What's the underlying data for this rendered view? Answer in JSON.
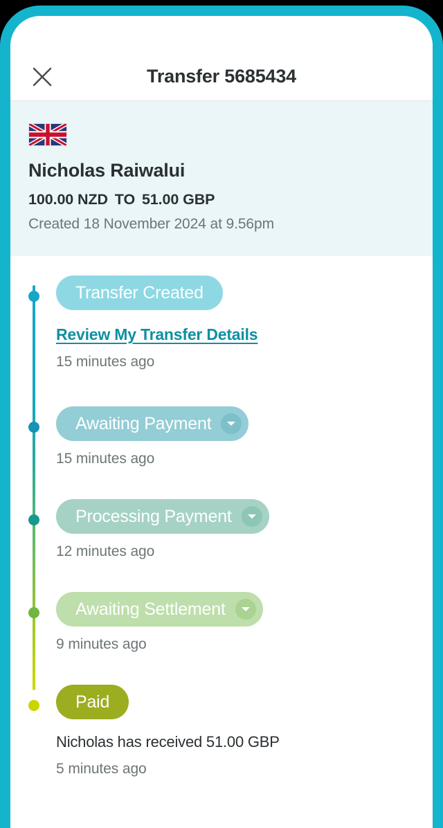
{
  "frame": {
    "accent_color": "#14b4cd",
    "background_color": "#000000"
  },
  "topbar": {
    "close_label": "Close",
    "close_icon": "close-icon",
    "title": "Transfer 5685434"
  },
  "summary": {
    "flag_icon": "united-kingdom-flag-icon",
    "flag_country": "United Kingdom",
    "recipient_name": "Nicholas Raiwalui",
    "amount_from": "100.00 NZD",
    "amount_separator": "TO",
    "amount_to": "51.00 GBP",
    "created": "Created 18 November 2024 at 9.56pm",
    "background_color": "#eaf6f8"
  },
  "timeline": {
    "rail_gradient_start": "#18a8c9",
    "rail_gradient_end": "#d3d800",
    "items": [
      {
        "status": "Transfer Created",
        "pill_color": "#8ed8e4",
        "dot_color": "#16a6c8",
        "has_caret": false,
        "link": "Review My Transfer Details",
        "note": null,
        "time": "15 minutes ago"
      },
      {
        "status": "Awaiting Payment",
        "pill_color": "#93cdd5",
        "dot_color": "#1593b5",
        "caret_bg": "#7dc0ca",
        "has_caret": true,
        "link": null,
        "note": null,
        "time": "15 minutes ago"
      },
      {
        "status": "Processing Payment",
        "pill_color": "#a5d2c4",
        "dot_color": "#18998f",
        "caret_bg": "#8ec6b5",
        "has_caret": true,
        "link": null,
        "note": null,
        "time": "12 minutes ago"
      },
      {
        "status": "Awaiting Settlement",
        "pill_color": "#bedeab",
        "dot_color": "#72b542",
        "caret_bg": "#a9d293",
        "has_caret": true,
        "link": null,
        "note": null,
        "time": "9 minutes ago"
      },
      {
        "status": "Paid",
        "pill_color": "#9dad20",
        "dot_color": "#ccd400",
        "has_caret": false,
        "link": null,
        "note": "Nicholas has received 51.00 GBP",
        "time": "5 minutes ago"
      }
    ]
  }
}
